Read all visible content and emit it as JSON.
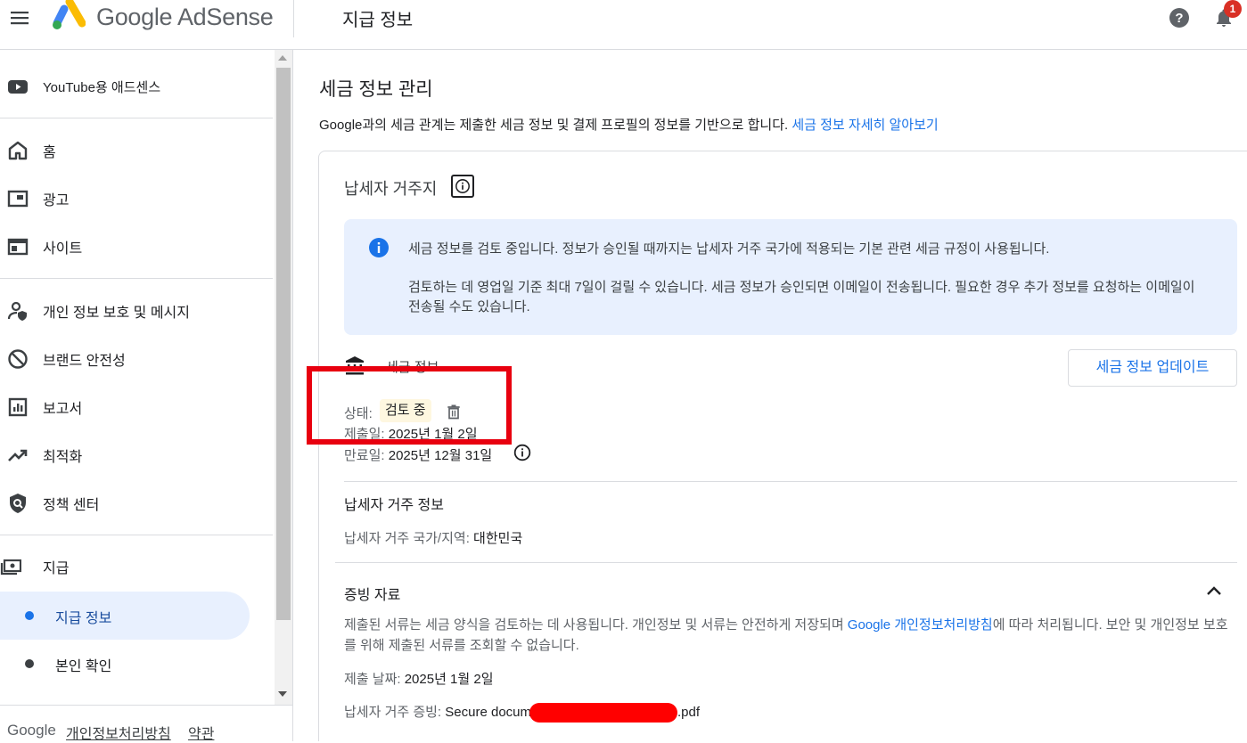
{
  "header": {
    "brand": "Google AdSense",
    "page_title": "지급 정보",
    "notification_count": "1"
  },
  "sidebar": {
    "items": [
      {
        "label": "YouTube용 애드센스",
        "icon": "youtube-icon"
      },
      {
        "label": "홈",
        "icon": "home-icon"
      },
      {
        "label": "광고",
        "icon": "ads-icon"
      },
      {
        "label": "사이트",
        "icon": "sites-icon"
      },
      {
        "label": "개인 정보 보호 및 메시지",
        "icon": "privacy-icon"
      },
      {
        "label": "브랜드 안전성",
        "icon": "block-icon"
      },
      {
        "label": "보고서",
        "icon": "reports-icon"
      },
      {
        "label": "최적화",
        "icon": "trending-icon"
      },
      {
        "label": "정책 센터",
        "icon": "policy-icon"
      },
      {
        "label": "지급",
        "icon": "payments-icon"
      }
    ],
    "sub_items": [
      {
        "label": "지급 정보",
        "active": true
      },
      {
        "label": "본인 확인",
        "active": false
      }
    ],
    "footer": {
      "google": "Google",
      "privacy": "개인정보처리방침",
      "terms": "약관"
    }
  },
  "main": {
    "section_title": "세금 정보 관리",
    "intro_text": "Google과의 세금 관계는 제출한 세금 정보 및 결제 프로필의 정보를 기반으로 합니다. ",
    "intro_link": "세금 정보 자세히 알아보기",
    "card": {
      "title": "납세자 거주지",
      "notice_line1": "세금 정보를 검토 중입니다. 정보가 승인될 때까지는 납세자 거주 국가에 적용되는 기본 관련 세금 규정이 사용됩니다.",
      "notice_line2": "검토하는 데 영업일 기준 최대 7일이 걸릴 수 있습니다. 세금 정보가 승인되면 이메일이 전송됩니다. 필요한 경우 추가 정보를 요청하는 이메일이 전송될 수도 있습니다.",
      "tax_info_label": "세금 정보",
      "update_button": "세금 정보 업데이트",
      "status_label": "상태:",
      "status_value": "검토 중",
      "submitted_label": "제출일: ",
      "submitted_value": "2025년 1월 2일",
      "expires_label": "만료일: ",
      "expires_value": "2025년 12월 31일",
      "residence_title": "납세자 거주 정보",
      "residence_label": "납세자 거주 국가/지역: ",
      "residence_value": "대한민국",
      "docs_title": "증빙 자료",
      "docs_desc_1": "제출된 서류는 세금 양식을 검토하는 데 사용됩니다. 개인정보 및 서류는 안전하게 저장되며 ",
      "docs_desc_link": "Google 개인정보처리방침",
      "docs_desc_2": "에 따라 처리됩니다. 보안 및 개인정보 보호를 위해 제출된 서류를 조회할 수 없습니다.",
      "docs_date_label": "제출 날짜: ",
      "docs_date_value": "2025년 1월 2일",
      "docs_file_label": "납세자 거주 증빙: ",
      "docs_file_prefix": "Secure docum",
      "docs_file_suffix": ".pdf"
    }
  },
  "colors": {
    "accent": "#1a73e8",
    "active_nav_bg": "#e8f0fe",
    "annotation_red": "#e8000f"
  }
}
